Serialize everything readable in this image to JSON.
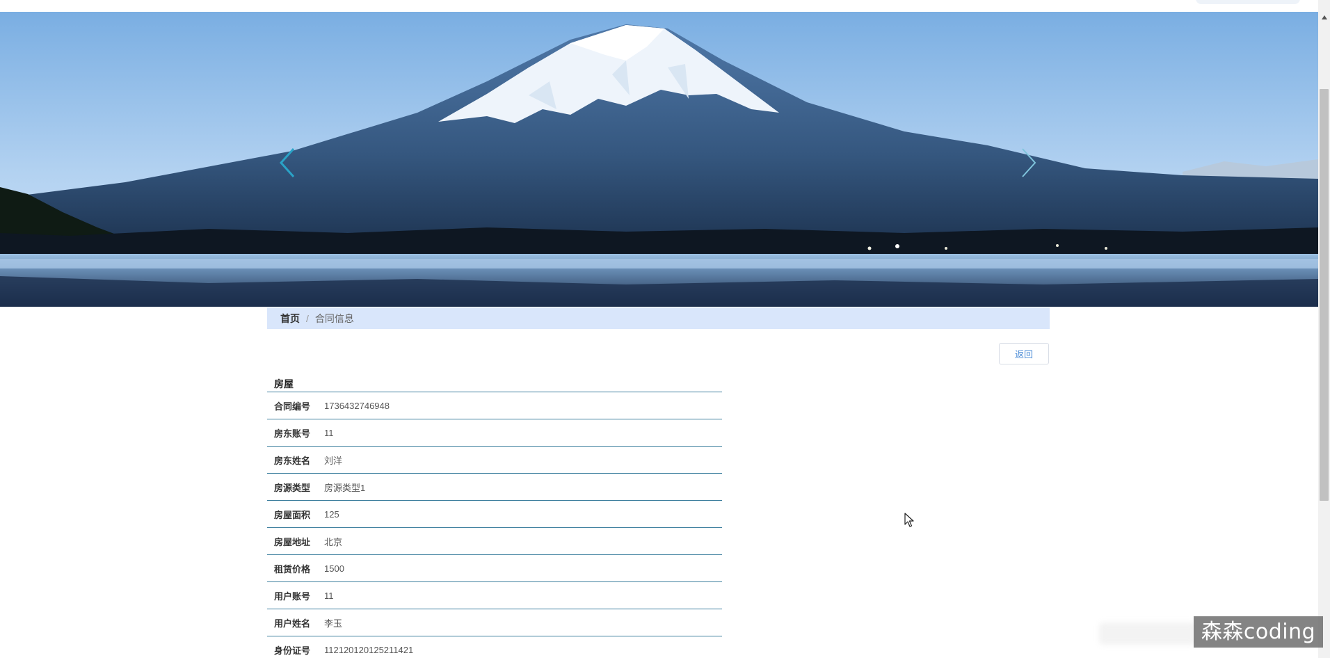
{
  "breadcrumb": {
    "home": "首页",
    "separator": "/",
    "current": "合同信息"
  },
  "actions": {
    "back_label": "返回"
  },
  "detail": {
    "heading": "房屋",
    "rows": [
      {
        "label": "合同编号",
        "value": "1736432746948"
      },
      {
        "label": "房东账号",
        "value": "11"
      },
      {
        "label": "房东姓名",
        "value": "刘洋"
      },
      {
        "label": "房源类型",
        "value": "房源类型1"
      },
      {
        "label": "房屋面积",
        "value": "125"
      },
      {
        "label": "房屋地址",
        "value": "北京"
      },
      {
        "label": "租赁价格",
        "value": "1500"
      },
      {
        "label": "用户账号",
        "value": "11"
      },
      {
        "label": "用户姓名",
        "value": "李玉"
      },
      {
        "label": "身份证号",
        "value": "112120120125211421"
      }
    ]
  },
  "watermark": {
    "text": "森森coding"
  },
  "colors": {
    "breadcrumb_bg": "#d9e6fb",
    "row_divider": "#3d7f9e",
    "link_blue": "#4a8bd6",
    "arrow_color": "#2aa3c7"
  },
  "icons": {
    "carousel_prev": "chevron-left-icon",
    "carousel_next": "chevron-right-icon",
    "cursor": "mouse-pointer-icon"
  }
}
